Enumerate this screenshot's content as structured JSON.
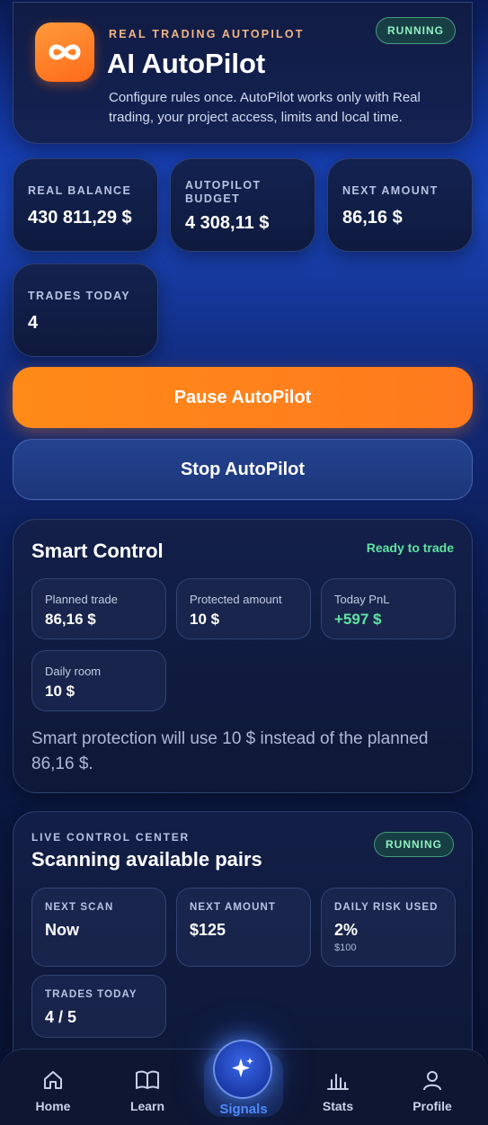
{
  "hero": {
    "kicker": "REAL TRADING AUTOPILOT",
    "title": "AI AutoPilot",
    "description": "Configure rules once. AutoPilot works only with Real trading, your project access, limits and local time.",
    "status": "RUNNING",
    "icon": "infinity-icon"
  },
  "stats": [
    {
      "label": "REAL BALANCE",
      "value": "430 811,29 $"
    },
    {
      "label": "AUTOPILOT BUDGET",
      "value": "4 308,11 $"
    },
    {
      "label": "NEXT AMOUNT",
      "value": "86,16 $"
    },
    {
      "label": "TRADES TODAY",
      "value": "4"
    }
  ],
  "actions": {
    "pause_label": "Pause AutoPilot",
    "stop_label": "Stop AutoPilot"
  },
  "smart_control": {
    "title": "Smart Control",
    "status": "Ready to trade",
    "tiles": [
      {
        "label": "Planned trade",
        "value": "86,16 $"
      },
      {
        "label": "Protected amount",
        "value": "10 $"
      },
      {
        "label": "Today PnL",
        "value": "+597 $"
      },
      {
        "label": "Daily room",
        "value": "10 $"
      }
    ],
    "note": "Smart protection will use 10 $ instead of the planned 86,16 $."
  },
  "live_control": {
    "kicker": "LIVE CONTROL CENTER",
    "title": "Scanning available pairs",
    "status": "RUNNING",
    "tiles": [
      {
        "label": "NEXT SCAN",
        "value": "Now"
      },
      {
        "label": "NEXT AMOUNT",
        "value": "$125"
      },
      {
        "label": "DAILY RISK USED",
        "value": "2%",
        "sub": "$100"
      },
      {
        "label": "TRADES TODAY",
        "value": "4 / 5"
      }
    ]
  },
  "nav": {
    "items": [
      {
        "label": "Home",
        "icon": "home-icon"
      },
      {
        "label": "Learn",
        "icon": "book-icon"
      },
      {
        "label": "Signals",
        "icon": "sparkle-icon"
      },
      {
        "label": "Stats",
        "icon": "bar-chart-icon"
      },
      {
        "label": "Profile",
        "icon": "user-icon"
      }
    ],
    "active": "Signals"
  },
  "colors": {
    "accent_orange": "#ff8a18",
    "success_green": "#5fe3a1",
    "kicker_peach": "#f2b584",
    "active_blue": "#4d8bff"
  }
}
